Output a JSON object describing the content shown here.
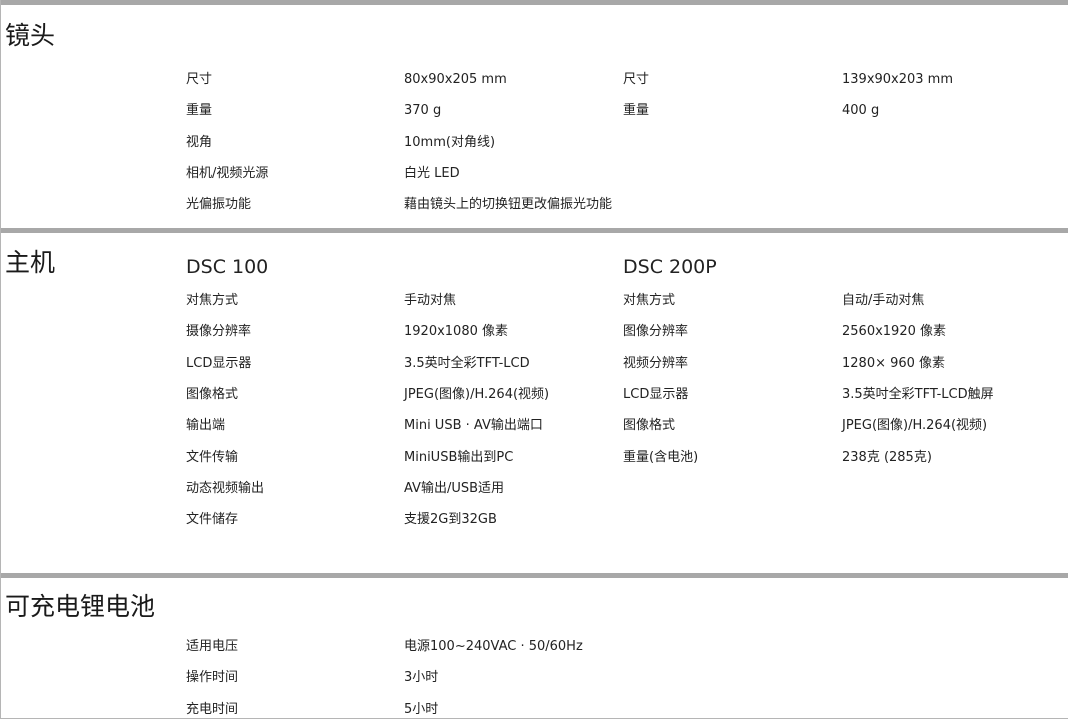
{
  "lens": {
    "title": "镜头",
    "rows": [
      {
        "l1": "尺寸",
        "v1": "80x90x205 mm",
        "l2": "尺寸",
        "v2": "139x90x203 mm"
      },
      {
        "l1": "重量",
        "v1": "370 g",
        "l2": "重量",
        "v2": "400 g"
      },
      {
        "l1": "视角",
        "v1": "10mm(对角线)",
        "l2": "",
        "v2": ""
      },
      {
        "l1": "相机/视频光源",
        "v1": "白光 LED",
        "l2": "",
        "v2": ""
      },
      {
        "l1": "光偏振功能",
        "v1": "藉由镜头上的切换钮更改偏振光功能",
        "l2": "",
        "v2": ""
      }
    ]
  },
  "host": {
    "title": "主机",
    "model1": "DSC 100",
    "model2": "DSC 200P",
    "rows": [
      {
        "l1": "对焦方式",
        "v1": "手动对焦",
        "l2": "对焦方式",
        "v2": "自动/手动对焦"
      },
      {
        "l1": "摄像分辨率",
        "v1": "1920x1080 像素",
        "l2": "图像分辨率",
        "v2": "2560x1920 像素"
      },
      {
        "l1": "LCD显示器",
        "v1": "3.5英吋全彩TFT-LCD",
        "l2": "视频分辨率",
        "v2": "1280× 960 像素"
      },
      {
        "l1": "图像格式",
        "v1": "JPEG(图像)/H.264(视频)",
        "l2": "LCD显示器",
        "v2": "3.5英吋全彩TFT-LCD触屏"
      },
      {
        "l1": "输出端",
        "v1": "Mini USB · AV输出端口",
        "l2": "图像格式",
        "v2": "JPEG(图像)/H.264(视频)"
      },
      {
        "l1": "文件传输",
        "v1": "MiniUSB输出到PC",
        "l2": "重量(含电池)",
        "v2": "238克 (285克)"
      },
      {
        "l1": "动态视频输出",
        "v1": "AV输出/USB适用",
        "l2": "",
        "v2": ""
      },
      {
        "l1": "文件储存",
        "v1": "支援2G到32GB",
        "l2": "",
        "v2": ""
      }
    ]
  },
  "battery": {
    "title": "可充电锂电池",
    "rows": [
      {
        "l1": "适用电压",
        "v1": "电源100~240VAC · 50/60Hz",
        "l2": "",
        "v2": ""
      },
      {
        "l1": "操作时间",
        "v1": "3小时",
        "l2": "",
        "v2": ""
      },
      {
        "l1": "充电时间",
        "v1": "5小时",
        "l2": "",
        "v2": ""
      }
    ]
  }
}
